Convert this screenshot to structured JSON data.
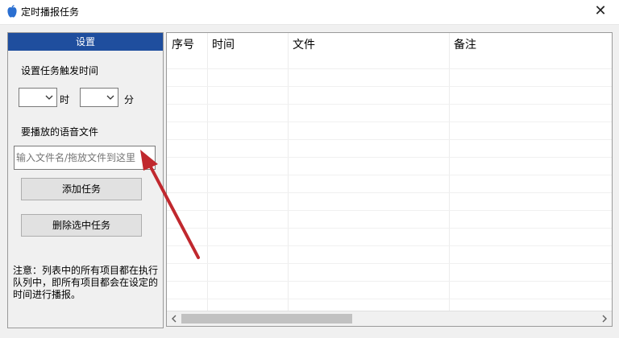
{
  "window": {
    "title": "定时播报任务",
    "close_symbol": "✕"
  },
  "settings": {
    "header": "设置",
    "trigger_label": "设置任务触发时间",
    "hour_value": "",
    "hour_unit": "时",
    "minute_value": "",
    "minute_unit": "分",
    "file_label": "要播放的语音文件",
    "file_placeholder": "输入文件名/拖放文件到这里",
    "file_value": "",
    "add_button": "添加任务",
    "delete_button": "删除选中任务",
    "note": "注意：列表中的所有项目都在执行队列中，即所有项目都会在设定的时间进行播报。"
  },
  "task_list": {
    "columns": [
      "序号",
      "时间",
      "文件",
      "备注"
    ],
    "rows": []
  },
  "colors": {
    "header_bg": "#1f4e9e",
    "arrow": "#c0282e"
  }
}
